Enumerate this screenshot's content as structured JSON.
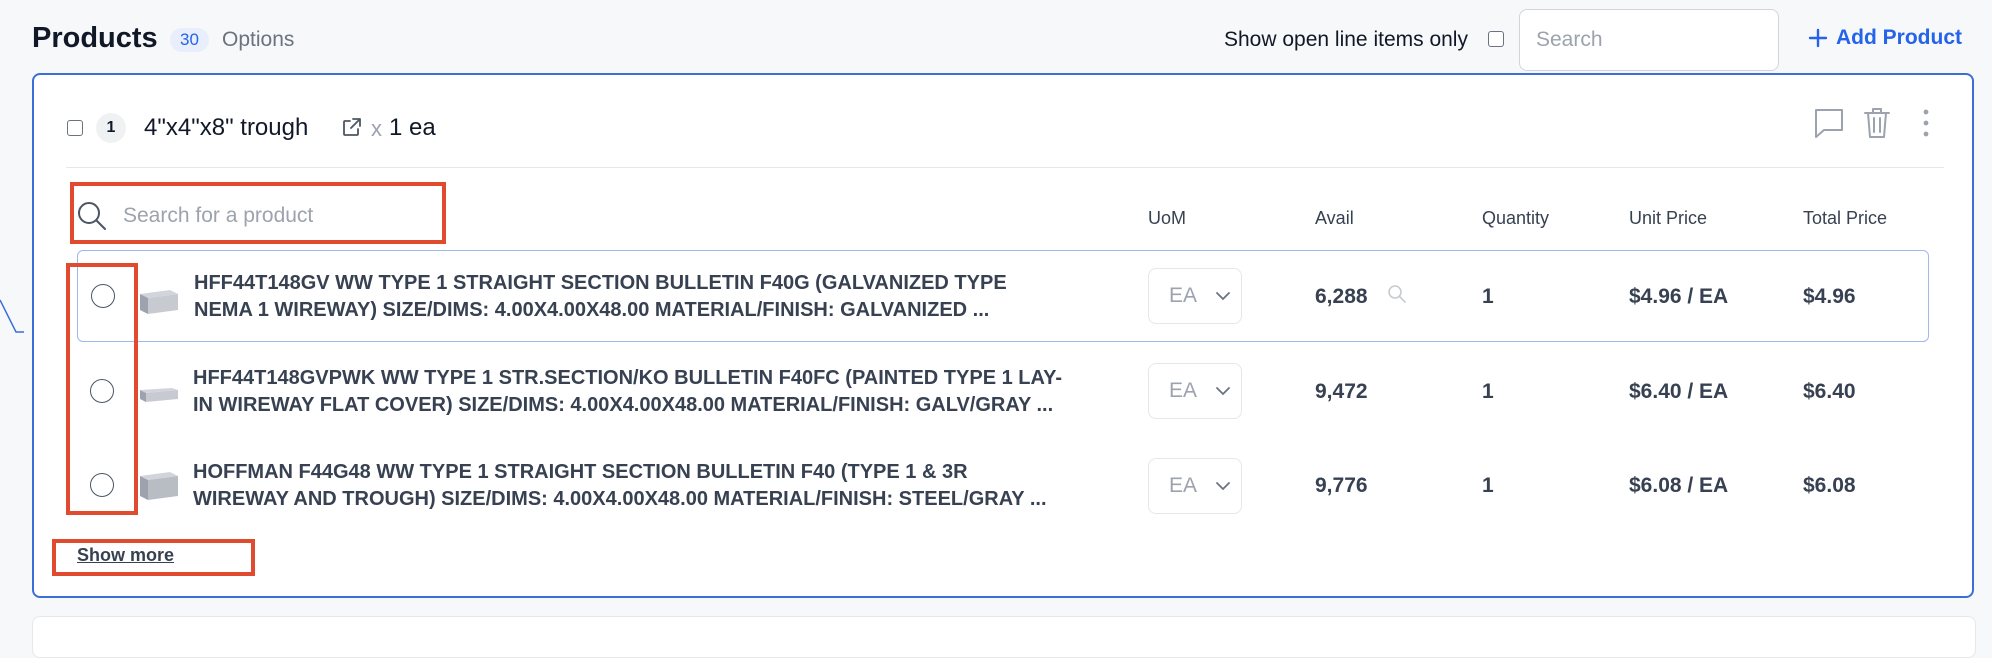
{
  "header": {
    "title": "Products",
    "count": "30",
    "options_label": "Options",
    "open_items_label": "Show open line items only",
    "search_placeholder": "Search",
    "add_product_label": "Add Product"
  },
  "item": {
    "line_number": "1",
    "name": "4\"x4\"x8\" trough",
    "x_symbol": "x",
    "quantity_text": "1 ea"
  },
  "product_search": {
    "placeholder": "Search for a product"
  },
  "columns": {
    "uom": "UoM",
    "avail": "Avail",
    "quantity": "Quantity",
    "unit_price": "Unit Price",
    "total_price": "Total Price"
  },
  "rows": [
    {
      "line1": "HFF44T148GV WW TYPE 1 STRAIGHT SECTION BULLETIN F40G (GALVANIZED TYPE",
      "line2": "NEMA 1 WIREWAY) SIZE/DIMS: 4.00X4.00X48.00 MATERIAL/FINISH: GALVANIZED ...",
      "uom": "EA",
      "avail": "6,288",
      "quantity": "1",
      "unit_price": "$4.96 / EA",
      "total_price": "$4.96"
    },
    {
      "line1": "HFF44T148GVPWK WW TYPE 1 STR.SECTION/KO BULLETIN F40FC (PAINTED TYPE 1 LAY-",
      "line2": "IN WIREWAY FLAT COVER) SIZE/DIMS: 4.00X4.00X48.00 MATERIAL/FINISH: GALV/GRAY ...",
      "uom": "EA",
      "avail": "9,472",
      "quantity": "1",
      "unit_price": "$6.40 / EA",
      "total_price": "$6.40"
    },
    {
      "line1": "HOFFMAN F44G48 WW TYPE 1 STRAIGHT SECTION BULLETIN F40 (TYPE 1 & 3R",
      "line2": "WIREWAY AND TROUGH) SIZE/DIMS: 4.00X4.00X48.00 MATERIAL/FINISH: STEEL/GRAY ...",
      "uom": "EA",
      "avail": "9,776",
      "quantity": "1",
      "unit_price": "$6.08 / EA",
      "total_price": "$6.08"
    }
  ],
  "show_more_label": "Show more",
  "colors": {
    "accent": "#2563eb",
    "annotation": "#e04a2e",
    "card_border": "#3b6fd8"
  }
}
